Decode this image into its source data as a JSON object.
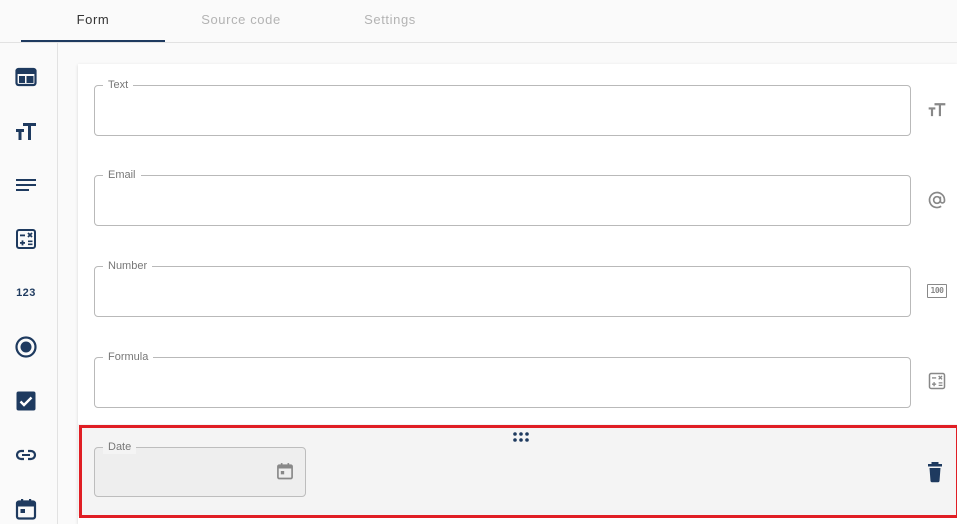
{
  "tabs": [
    {
      "label": "Form",
      "active": true
    },
    {
      "label": "Source code",
      "active": false
    },
    {
      "label": "Settings",
      "active": false
    }
  ],
  "sidebar": {
    "items": [
      {
        "icon": "layout-icon",
        "name": "layout"
      },
      {
        "icon": "text-format-icon",
        "name": "text"
      },
      {
        "icon": "textarea-icon",
        "name": "textarea"
      },
      {
        "icon": "calculator-icon",
        "name": "formula"
      },
      {
        "icon": "number-icon",
        "label": "123",
        "name": "number"
      },
      {
        "icon": "radio-icon",
        "name": "radio"
      },
      {
        "icon": "checkbox-icon",
        "name": "checkbox"
      },
      {
        "icon": "link-icon",
        "name": "link"
      },
      {
        "icon": "calendar-icon",
        "name": "date"
      }
    ]
  },
  "fields": [
    {
      "label": "Text",
      "icon": "text-format-icon"
    },
    {
      "label": "Email",
      "icon": "at-icon"
    },
    {
      "label": "Number",
      "icon": "number-box-icon",
      "icon_text": "100"
    },
    {
      "label": "Formula",
      "icon": "calculator-icon"
    }
  ],
  "selected_field": {
    "label": "Date",
    "icon": "calendar-icon",
    "action_icon": "delete-icon",
    "handle_icon": "drag-handle-icon"
  },
  "colors": {
    "brand": "#1e3a5f",
    "selection_border": "#e01e24",
    "field_icon": "#888888"
  }
}
